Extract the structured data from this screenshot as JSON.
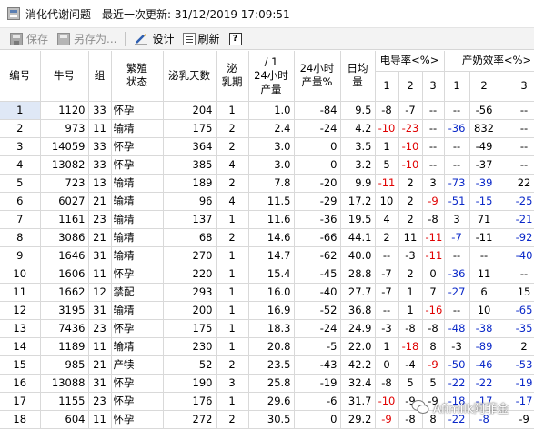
{
  "window": {
    "title": "消化代谢问题 - 最近一次更新: 31/12/2019 17:09:51"
  },
  "toolbar": {
    "save_label": "保存",
    "save_as_label": "另存为...",
    "design_label": "设计",
    "refresh_label": "刷新",
    "help_label": "?"
  },
  "table": {
    "headers": {
      "id": "编号",
      "cow": "牛号",
      "group": "组",
      "repro": "繁殖\n状态",
      "days": "泌乳天数",
      "parity": "泌\n乳期",
      "yield24": "/ 1\n24小时\n产量",
      "yield24_pct": "24小时\n产量%",
      "avg": "日均\n量",
      "cond_group": "电导率<%>",
      "eff_group": "产奶效率<%>",
      "sub1": "1",
      "sub2": "2",
      "sub3": "3"
    },
    "rows": [
      [
        "1",
        "1120",
        "33",
        "怀孕",
        "204",
        "1",
        "1.0",
        "-84",
        "9.5",
        "-8",
        "-7",
        "--",
        "--",
        "-56",
        "--"
      ],
      [
        "2",
        "973",
        "11",
        "输精",
        "175",
        "2",
        "2.4",
        "-24",
        "4.2",
        "-10",
        "-23",
        "--",
        "-36",
        "832",
        "--"
      ],
      [
        "3",
        "14059",
        "33",
        "怀孕",
        "364",
        "2",
        "3.0",
        "0",
        "3.5",
        "1",
        "-10",
        "--",
        "--",
        "-49",
        "--"
      ],
      [
        "4",
        "13082",
        "33",
        "怀孕",
        "385",
        "4",
        "3.0",
        "0",
        "3.2",
        "5",
        "-10",
        "--",
        "--",
        "-37",
        "--"
      ],
      [
        "5",
        "723",
        "13",
        "输精",
        "189",
        "2",
        "7.8",
        "-20",
        "9.9",
        "-11",
        "2",
        "3",
        "-73",
        "-39",
        "22"
      ],
      [
        "6",
        "6027",
        "21",
        "输精",
        "96",
        "4",
        "11.5",
        "-29",
        "17.2",
        "10",
        "2",
        "-9",
        "-51",
        "-15",
        "-25"
      ],
      [
        "7",
        "1161",
        "23",
        "输精",
        "137",
        "1",
        "11.6",
        "-36",
        "19.5",
        "4",
        "2",
        "-8",
        "3",
        "71",
        "-21"
      ],
      [
        "8",
        "3086",
        "21",
        "输精",
        "68",
        "2",
        "14.6",
        "-66",
        "44.1",
        "2",
        "11",
        "-11",
        "-7",
        "-11",
        "-92"
      ],
      [
        "9",
        "1646",
        "31",
        "输精",
        "270",
        "1",
        "14.7",
        "-62",
        "40.0",
        "--",
        "-3",
        "-11",
        "--",
        "--",
        "-40"
      ],
      [
        "10",
        "1606",
        "11",
        "怀孕",
        "220",
        "1",
        "15.4",
        "-45",
        "28.8",
        "-7",
        "2",
        "0",
        "-36",
        "11",
        "--"
      ],
      [
        "11",
        "1662",
        "12",
        "禁配",
        "293",
        "1",
        "16.0",
        "-40",
        "27.7",
        "-7",
        "1",
        "7",
        "-27",
        "6",
        "15"
      ],
      [
        "12",
        "3195",
        "31",
        "输精",
        "200",
        "1",
        "16.9",
        "-52",
        "36.8",
        "--",
        "1",
        "-16",
        "--",
        "10",
        "-65"
      ],
      [
        "13",
        "7436",
        "23",
        "怀孕",
        "175",
        "1",
        "18.3",
        "-24",
        "24.9",
        "-3",
        "-8",
        "-8",
        "-48",
        "-38",
        "-35"
      ],
      [
        "14",
        "1189",
        "11",
        "输精",
        "230",
        "1",
        "20.8",
        "-5",
        "22.0",
        "1",
        "-18",
        "8",
        "-3",
        "-89",
        "2"
      ],
      [
        "15",
        "985",
        "21",
        "产犊",
        "52",
        "2",
        "23.5",
        "-43",
        "42.2",
        "0",
        "-4",
        "-9",
        "-50",
        "-46",
        "-53"
      ],
      [
        "16",
        "13088",
        "31",
        "怀孕",
        "190",
        "3",
        "25.8",
        "-19",
        "32.4",
        "-8",
        "5",
        "5",
        "-22",
        "-22",
        "-19"
      ],
      [
        "17",
        "1155",
        "23",
        "怀孕",
        "176",
        "1",
        "29.6",
        "-6",
        "31.7",
        "-10",
        "-9",
        "-9",
        "-18",
        "-17",
        "-17"
      ],
      [
        "18",
        "604",
        "11",
        "怀孕",
        "272",
        "2",
        "30.5",
        "0",
        "29.2",
        "-9",
        "-8",
        "8",
        "-22",
        "-8",
        "-9"
      ]
    ],
    "cell_colors": [
      [
        "",
        "",
        "",
        "",
        "",
        "",
        "",
        "",
        "",
        "",
        "",
        "",
        "",
        "",
        ""
      ],
      [
        "",
        "",
        "",
        "",
        "",
        "",
        "",
        "",
        "",
        "red",
        "red",
        "",
        "blue",
        "",
        ""
      ],
      [
        "",
        "",
        "",
        "",
        "",
        "",
        "",
        "",
        "",
        "",
        "red",
        "",
        "",
        "",
        ""
      ],
      [
        "",
        "",
        "",
        "",
        "",
        "",
        "",
        "",
        "",
        "",
        "red",
        "",
        "",
        "",
        ""
      ],
      [
        "",
        "",
        "",
        "",
        "",
        "",
        "",
        "",
        "",
        "red",
        "",
        "",
        "blue",
        "blue",
        ""
      ],
      [
        "",
        "",
        "",
        "",
        "",
        "",
        "",
        "",
        "",
        "",
        "",
        "red",
        "blue",
        "blue",
        "blue"
      ],
      [
        "",
        "",
        "",
        "",
        "",
        "",
        "",
        "",
        "",
        "",
        "",
        "",
        "",
        "",
        "blue"
      ],
      [
        "",
        "",
        "",
        "",
        "",
        "",
        "",
        "",
        "",
        "",
        "",
        "red",
        "blue",
        "",
        "blue"
      ],
      [
        "",
        "",
        "",
        "",
        "",
        "",
        "",
        "",
        "",
        "",
        "",
        "red",
        "",
        "",
        "blue"
      ],
      [
        "",
        "",
        "",
        "",
        "",
        "",
        "",
        "",
        "",
        "",
        "",
        "",
        "blue",
        "",
        ""
      ],
      [
        "",
        "",
        "",
        "",
        "",
        "",
        "",
        "",
        "",
        "",
        "",
        "",
        "blue",
        "",
        ""
      ],
      [
        "",
        "",
        "",
        "",
        "",
        "",
        "",
        "",
        "",
        "",
        "",
        "red",
        "",
        "",
        "blue"
      ],
      [
        "",
        "",
        "",
        "",
        "",
        "",
        "",
        "",
        "",
        "",
        "",
        "",
        "blue",
        "blue",
        "blue"
      ],
      [
        "",
        "",
        "",
        "",
        "",
        "",
        "",
        "",
        "",
        "",
        "red",
        "",
        "",
        "blue",
        ""
      ],
      [
        "",
        "",
        "",
        "",
        "",
        "",
        "",
        "",
        "",
        "",
        "",
        "red",
        "blue",
        "blue",
        "blue"
      ],
      [
        "",
        "",
        "",
        "",
        "",
        "",
        "",
        "",
        "",
        "",
        "",
        "",
        "blue",
        "blue",
        "blue"
      ],
      [
        "",
        "",
        "",
        "",
        "",
        "",
        "",
        "",
        "",
        "red",
        "",
        "",
        "blue",
        "blue",
        "blue"
      ],
      [
        "",
        "",
        "",
        "",
        "",
        "",
        "",
        "",
        "",
        "red",
        "",
        "",
        "blue",
        "blue",
        ""
      ]
    ]
  },
  "watermark": {
    "text": "Afimilk阿菲金"
  },
  "colors": {
    "negative_red": "#e00000",
    "negative_blue": "#0a28c8",
    "grid_line": "#d9d9d9"
  }
}
